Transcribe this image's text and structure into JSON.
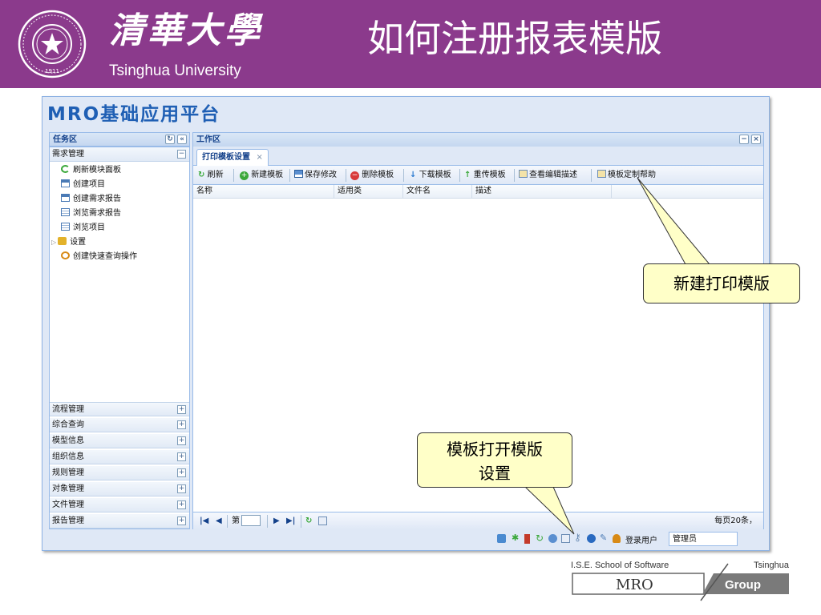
{
  "header": {
    "seal_text": "1911",
    "calligraphy": "清華大學",
    "university": "Tsinghua University",
    "slide_title": "如何注册报表模版"
  },
  "app": {
    "title": "MRO基础应用平台",
    "task_panel": {
      "title": "任务区",
      "group_open": "需求管理",
      "tree_items": [
        {
          "label": "刷新模块面板",
          "icon": "refresh-icon"
        },
        {
          "label": "创建项目",
          "icon": "form-icon"
        },
        {
          "label": "创建需求报告",
          "icon": "form-icon"
        },
        {
          "label": "浏览需求报告",
          "icon": "grid-icon"
        },
        {
          "label": "浏览项目",
          "icon": "grid-icon"
        },
        {
          "label": "设置",
          "icon": "settings-icon"
        },
        {
          "label": "创建快速查询操作",
          "icon": "search-icon"
        }
      ],
      "groups_collapsed": [
        "流程管理",
        "综合查询",
        "模型信息",
        "组织信息",
        "规则管理",
        "对象管理",
        "文件管理",
        "报告管理"
      ]
    },
    "work_area": {
      "title": "工作区",
      "tab": "打印模板设置",
      "toolbar": {
        "refresh": "刷新",
        "new": "新建模板",
        "save": "保存修改",
        "delete": "删除模板",
        "download": "下载模板",
        "upload": "重传模板",
        "edit_desc": "查看编辑描述",
        "help": "模板定制帮助"
      },
      "columns": [
        "名称",
        "适用类",
        "文件名",
        "描述"
      ],
      "pager": {
        "page_prefix": "第",
        "page_value": "",
        "page_size": "每页20条，"
      }
    },
    "status": {
      "login_label": "登录用户",
      "login_value": "管理员"
    }
  },
  "callouts": {
    "new_template": "新建打印模版",
    "open_template_line1": "模板打开模版",
    "open_template_line2": "设置"
  },
  "footer": {
    "school": "I.S.E. School of Software",
    "tsinghua": "Tsinghua",
    "mro": "MRO",
    "group": "Group"
  },
  "colors": {
    "banner": "#8b3a8c",
    "app_title": "#1f5fb4",
    "panel_header": "#15428b",
    "callout_fill": "#ffffc8"
  }
}
